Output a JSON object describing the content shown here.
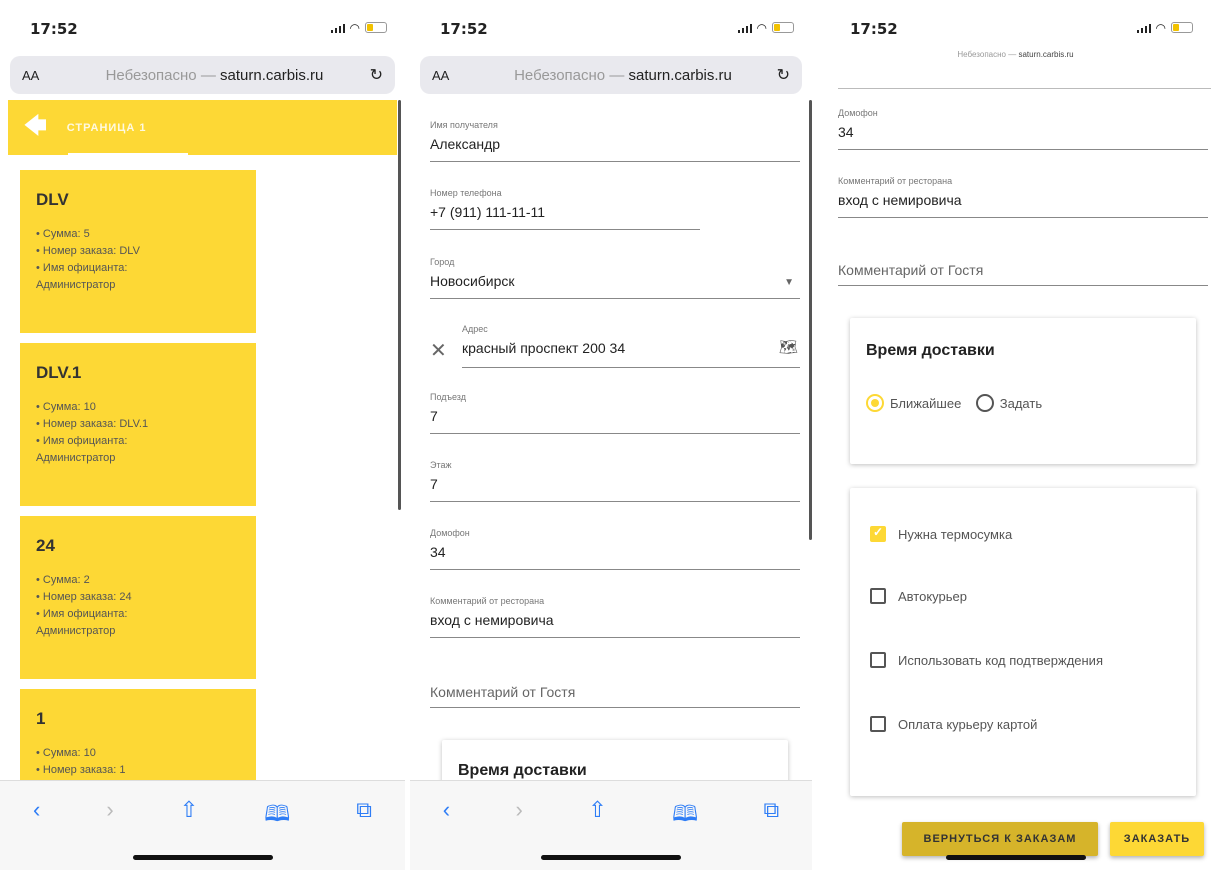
{
  "status": {
    "time": "17:52"
  },
  "browser": {
    "aa": "AA",
    "insecure": "Небезопасно —",
    "domain": "saturn.carbis.ru",
    "small_insecure": "Небезопасно —",
    "small_domain": "saturn.carbis.ru"
  },
  "screen1": {
    "page_title": "СТРАНИЦА 1",
    "cards": [
      {
        "title": "DLV",
        "sum": "Сумма: 5",
        "order": "Номер заказа: DLV",
        "waiter": "Имя официанта:",
        "waiter_name": "Администратор"
      },
      {
        "title": "DLV.1",
        "sum": "Сумма: 10",
        "order": "Номер заказа: DLV.1",
        "waiter": "Имя официанта:",
        "waiter_name": "Администратор"
      },
      {
        "title": "24",
        "sum": "Сумма: 2",
        "order": "Номер заказа: 24",
        "waiter": "Имя официанта:",
        "waiter_name": "Администратор"
      },
      {
        "title": "1",
        "sum": "Сумма: 10",
        "order": "Номер заказа: 1",
        "waiter": "",
        "waiter_name": ""
      }
    ]
  },
  "form": {
    "recipient_label": "Имя получателя",
    "recipient_value": "Александр",
    "phone_label": "Номер телефона",
    "phone_value": "+7 (911) 111-11-11",
    "city_label": "Город",
    "city_value": "Новосибирск",
    "address_label": "Адрес",
    "address_value": "красный проспект 200 34",
    "entrance_label": "Подъезд",
    "entrance_value": "7",
    "floor_label": "Этаж",
    "floor_value": "7",
    "intercom_label": "Домофон",
    "intercom_value": "34",
    "restaurant_comment_label": "Комментарий от ресторана",
    "restaurant_comment_value": "вход с немировича",
    "guest_comment_placeholder": "Комментарий от Гостя",
    "delivery_title": "Время доставки",
    "radio_nearest": "Ближайшее",
    "radio_set": "Задать",
    "thermo_bag": "Нужна термосумка",
    "auto_courier": "Автокурьер",
    "use_code": "Использовать код подтверждения",
    "card_payment": "Оплата курьеру картой",
    "back_button": "ВЕРНУТЬСЯ К ЗАКАЗАМ",
    "order_button": "ЗАКАЗАТЬ"
  },
  "colors": {
    "accent": "#fdd835",
    "link": "#2e7df6"
  }
}
